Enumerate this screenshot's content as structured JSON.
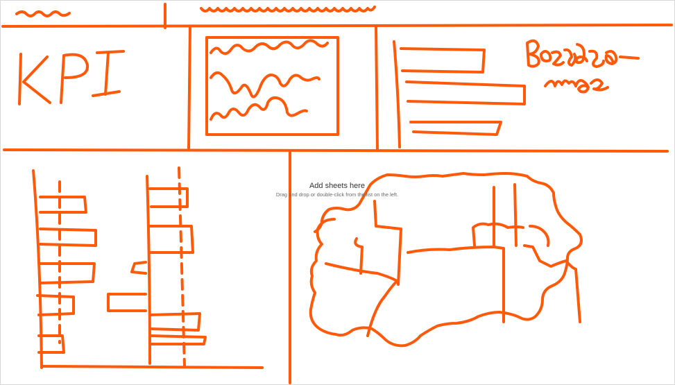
{
  "colors": {
    "sketch": "#ff5a0a",
    "background": "#ffffff",
    "placeholder_text": "#333333",
    "placeholder_subtext": "#6a6a6a"
  },
  "sheet_placeholder": {
    "title": "Add sheets here",
    "subtitle": "Drag and drop or double-click from the list on the left."
  },
  "sketch_labels": {
    "kpi": "KPI"
  }
}
